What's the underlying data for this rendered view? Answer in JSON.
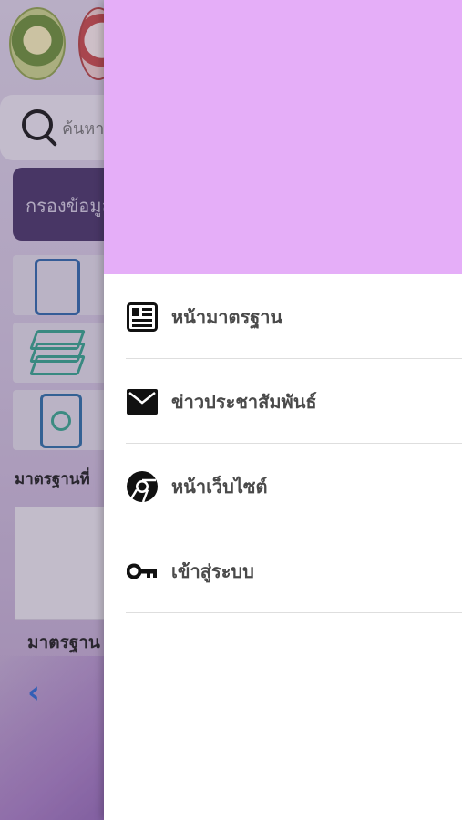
{
  "background": {
    "search_placeholder": "ค้นหา",
    "filter_label": "กรองข้อมูล",
    "section_heading": "มาตรฐานที่",
    "card_caption": "มาตรฐาน",
    "back_chevron": "‹"
  },
  "drawer": {
    "header_color": "#e5aef8",
    "items": [
      {
        "label": "หน้ามาตรฐาน",
        "icon": "newspaper-icon"
      },
      {
        "label": "ข่าวประชาสัมพันธ์",
        "icon": "mail-icon"
      },
      {
        "label": "หน้าเว็บไซต์",
        "icon": "chrome-icon"
      },
      {
        "label": "เข้าสู่ระบบ",
        "icon": "key-icon"
      }
    ]
  }
}
